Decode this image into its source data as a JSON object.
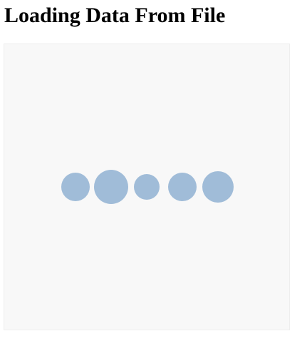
{
  "page": {
    "title": "Loading Data From File"
  },
  "visualization": {
    "background_color": "#f8f8f8",
    "circle_color": "#a0bcd8",
    "circles": [
      {
        "id": "circle-1"
      },
      {
        "id": "circle-2"
      },
      {
        "id": "circle-3"
      },
      {
        "id": "circle-4"
      },
      {
        "id": "circle-5"
      }
    ]
  }
}
